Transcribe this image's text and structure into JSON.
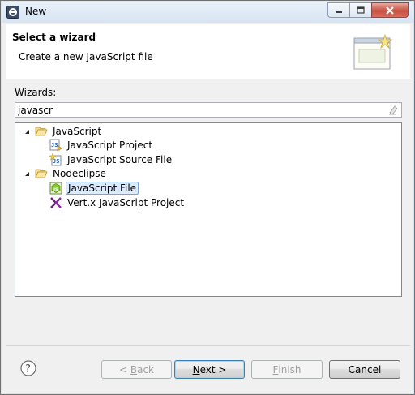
{
  "window": {
    "title": "New"
  },
  "banner": {
    "title": "Select a wizard",
    "description": "Create a new JavaScript file"
  },
  "wizards": {
    "label_accel": "W",
    "label_rest": "izards:",
    "filter_value": "javascr"
  },
  "tree": {
    "categories": [
      {
        "label": "JavaScript",
        "expanded": true,
        "items": [
          {
            "label": "JavaScript Project",
            "icon": "js-project-icon"
          },
          {
            "label": "JavaScript Source File",
            "icon": "js-source-file-icon"
          }
        ]
      },
      {
        "label": "Nodeclipse",
        "expanded": true,
        "items": [
          {
            "label": "JavaScript File",
            "icon": "nodeclipse-js-file-icon",
            "selected": true
          },
          {
            "label": "Vert.x JavaScript Project",
            "icon": "vertx-icon"
          }
        ]
      }
    ]
  },
  "buttons": {
    "back_prefix": "< ",
    "back_accel": "B",
    "back_rest": "ack",
    "next_accel": "N",
    "next_rest": "ext >",
    "finish_accel": "F",
    "finish_rest": "inish",
    "cancel": "Cancel"
  },
  "colors": {
    "selection_bg": "#dcebfc",
    "selection_border": "#7da2ce",
    "folder": "#e8c66a"
  }
}
